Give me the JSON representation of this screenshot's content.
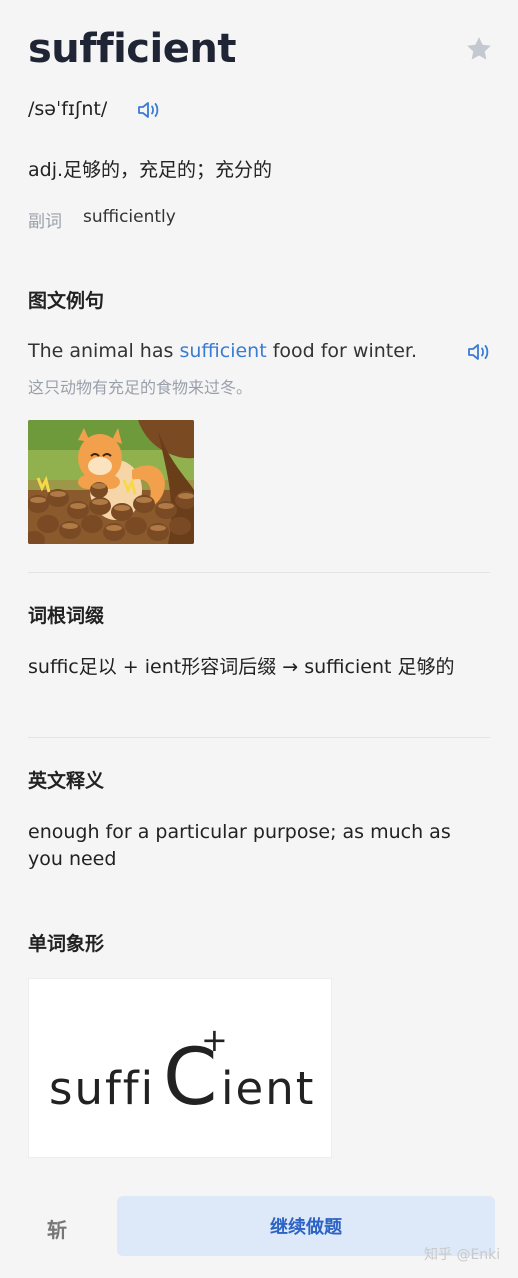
{
  "word": "sufficient",
  "phonetic": "/səˈfɪʃnt/",
  "definition": "adj.足够的，充足的；充分的",
  "adverb": {
    "label": "副词",
    "value": "sufficiently"
  },
  "sections": {
    "example_title": "图文例句",
    "roots_title": "词根词缀",
    "english_title": "英文释义",
    "shape_title": "单词象形"
  },
  "example": {
    "en_before": "The animal has ",
    "en_highlight": "sufficient",
    "en_after": " food for winter.",
    "zh": "这只动物有充足的食物来过冬。"
  },
  "roots_text": "suffic足以 + ient形容词后缀 → sufficient 足够的",
  "english_definition": "enough for a particular purpose; as much as you need",
  "word_shape": {
    "left": "suffi",
    "big": "C",
    "plus": "+",
    "right": "ient"
  },
  "footer": {
    "kill_label": "斩",
    "continue_label": "继续做题"
  },
  "watermark": "知乎 @Enki",
  "colors": {
    "accent": "#3a7bd5",
    "button_bg": "#dde9f9",
    "button_text": "#2d63c4"
  }
}
